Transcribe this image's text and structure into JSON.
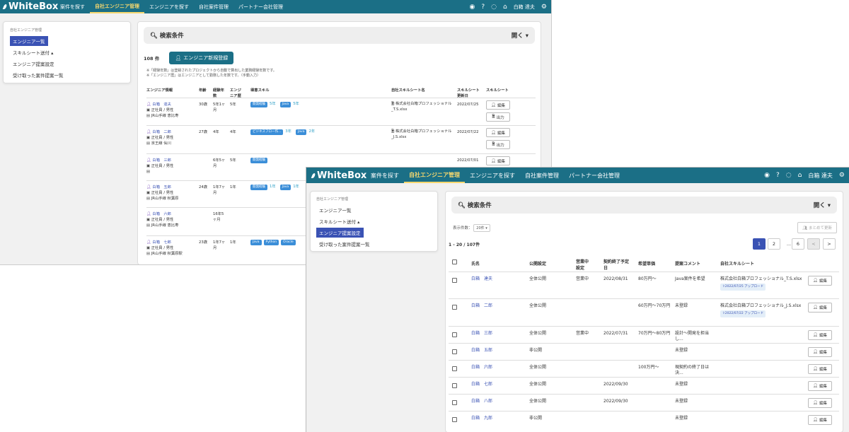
{
  "nav": {
    "logo": "WhiteBox",
    "items": [
      "案件を探す",
      "自社エンジニア管理",
      "エンジニアを探す",
      "自社案件管理",
      "パートナー会社管理"
    ],
    "active_index": 1,
    "user": "白箱",
    "user2": "達夫"
  },
  "sidebar": {
    "title": "自社エンジニア管理",
    "items": [
      "エンジニア一覧",
      "スキルシート送付",
      "エンジニア提案設定",
      "受け取った案件提案一覧"
    ]
  },
  "win1": {
    "search_title": "検索条件",
    "open_label": "開く",
    "count": "108 件",
    "register_button": "エンジニア新規登録",
    "note1": "※「経験年数」は登録されたプロジェクトから自動で算出した業務経験年数です。",
    "note2": "※「エンジニア歴」はエンジニアとして勤務した年数です。（手動入力）",
    "headers": [
      "エンジニア情報",
      "年齢",
      "経験年数",
      "エンジニア歴",
      "得意スキル",
      "自社スキルシート名",
      "スキルシート更新日",
      "スキルシート"
    ],
    "edit_label": "編集",
    "output_label": "出力",
    "rows": [
      {
        "name": "白箱　達夫",
        "status": "正社員 / 男性",
        "station": "JR山手線 恵比寿",
        "age": "30歳",
        "exp": "5年1ヶ月",
        "eng": "5年",
        "skills": [
          [
            "開発経験",
            "5年"
          ],
          [
            "Java",
            "5年"
          ]
        ],
        "sheet": "株式会社白箱プロフェッショナル_T.S.xlsx",
        "date": "2022/07/25"
      },
      {
        "name": "白箱　二郎",
        "status": "正社員 / 男性",
        "station": "京王線 仙川",
        "age": "27歳",
        "exp": "4年",
        "eng": "4年",
        "skills": [
          [
            "ビジネスフロー作...",
            "3年"
          ],
          [
            "Java",
            "2年"
          ]
        ],
        "sheet": "株式会社白箱プロフェッショナル_J.S.xlsx",
        "date": "2022/07/22"
      },
      {
        "name": "白箱　三郎",
        "status": "正社員 / 男性",
        "station": "",
        "age": "",
        "exp": "6年5ヶ月",
        "eng": "5年",
        "skills": [
          [
            "開発経験",
            ""
          ]
        ],
        "sheet": "",
        "date": "2022/07/01"
      },
      {
        "name": "白箱　五郎",
        "status": "正社員 / 男性",
        "station": "JR山手線 秋葉原",
        "age": "24歳",
        "exp": "1年7ヶ月",
        "eng": "1年",
        "skills": [
          [
            "開発経験",
            "1年"
          ],
          [
            "Java",
            "1年"
          ]
        ],
        "sheet": "",
        "date": ""
      },
      {
        "name": "白箱　六郎",
        "status": "正社員 / 男性",
        "station": "JR山手線 恵比寿",
        "age": "",
        "exp": "16年5ヶ月",
        "eng": "",
        "skills": [],
        "sheet": "",
        "date": ""
      },
      {
        "name": "白箱　七郎",
        "status": "正社員 / 男性",
        "station": "JR山手線 秋葉原駅",
        "age": "23歳",
        "exp": "1年7ヶ月",
        "eng": "1年",
        "skills": [
          [
            "Java",
            ""
          ],
          [
            "Python",
            ""
          ],
          [
            "Oracle",
            ""
          ]
        ],
        "sheet": "",
        "date": ""
      }
    ]
  },
  "win2": {
    "search_title": "検索条件",
    "open_label": "開く",
    "bulk_button": "まとめて更新",
    "per_page_label": "表示件数：",
    "per_page_value": "20件",
    "range": "1 - 20 / 107件",
    "pager": [
      "1",
      "2",
      "...",
      "6",
      "<",
      ">"
    ],
    "headers": [
      "氏名",
      "公開設定",
      "営業中設定",
      "契約終了予定日",
      "希望単価",
      "提案コメント",
      "自社スキルシート"
    ],
    "edit_label": "編集",
    "rows": [
      {
        "name": "白箱　達夫",
        "pub": "全体公開",
        "sales": "営業中",
        "end": "2022/08/31",
        "price": "80万円〜",
        "comment": "Java案件を希望",
        "sheet": "株式会社白箱プロフェッショナル_T.S.xlsx",
        "upload": "2022/07/25 アップロード"
      },
      {
        "name": "白箱　二郎",
        "pub": "全体公開",
        "sales": "",
        "end": "",
        "price": "60万円〜70万円",
        "comment": "未登録",
        "sheet": "株式会社白箱プロフェッショナル_J.S.xlsx",
        "upload": "2022/07/22 アップロード"
      },
      {
        "name": "白箱　三郎",
        "pub": "全体公開",
        "sales": "営業中",
        "end": "2022/07/31",
        "price": "70万円〜80万円",
        "comment": "設計〜開発を担当し...",
        "sheet": "",
        "upload": ""
      },
      {
        "name": "白箱　五郎",
        "pub": "非公開",
        "sales": "",
        "end": "",
        "price": "",
        "comment": "未登録",
        "sheet": "",
        "upload": ""
      },
      {
        "name": "白箱　六郎",
        "pub": "全体公開",
        "sales": "",
        "end": "",
        "price": "100万円〜",
        "comment": "現契約の終了日は決...",
        "sheet": "",
        "upload": ""
      },
      {
        "name": "白箱　七郎",
        "pub": "全体公開",
        "sales": "",
        "end": "2022/09/30",
        "price": "",
        "comment": "未登録",
        "sheet": "",
        "upload": ""
      },
      {
        "name": "白箱　八郎",
        "pub": "全体公開",
        "sales": "",
        "end": "2022/09/30",
        "price": "",
        "comment": "未登録",
        "sheet": "",
        "upload": ""
      },
      {
        "name": "白箱　九郎",
        "pub": "非公開",
        "sales": "",
        "end": "",
        "price": "",
        "comment": "未登録",
        "sheet": "",
        "upload": ""
      }
    ]
  }
}
